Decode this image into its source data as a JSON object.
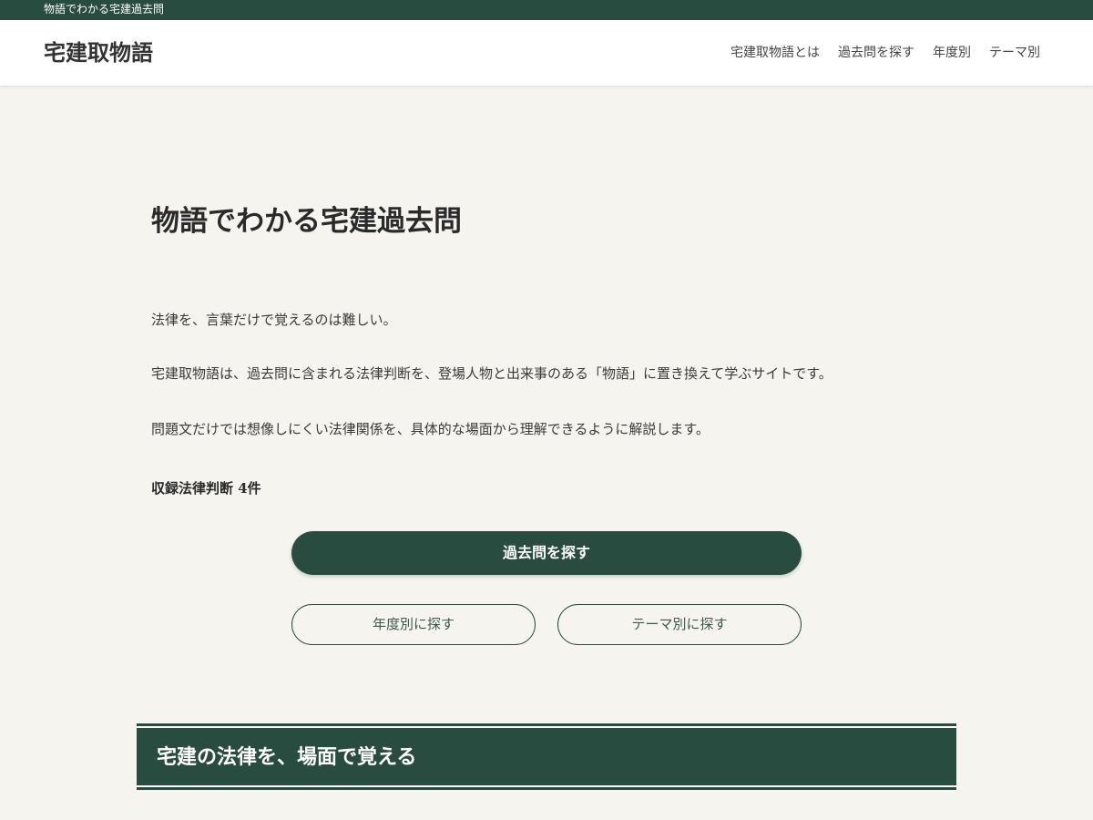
{
  "topbar": {
    "tagline": "物語でわかる宅建過去問"
  },
  "header": {
    "site_title": "宅建取物語",
    "nav": [
      {
        "label": "宅建取物語とは"
      },
      {
        "label": "過去問を探す"
      },
      {
        "label": "年度別"
      },
      {
        "label": "テーマ別"
      }
    ]
  },
  "main": {
    "title": "物語でわかる宅建過去問",
    "paragraphs": [
      "法律を、言葉だけで覚えるのは難しい。",
      "宅建取物語は、過去問に含まれる法律判断を、登場人物と出来事のある「物語」に置き換えて学ぶサイトです。",
      "問題文だけでは想像しにくい法律関係を、具体的な場面から理解できるように解説します。"
    ],
    "count_text": "収録法律判断 4件",
    "primary_button": "過去問を探す",
    "year_button": "年度別に探す",
    "theme_button": "テーマ別に探す"
  },
  "section": {
    "title": "宅建の法律を、場面で覚える"
  },
  "colors": {
    "brand_green": "#284c40",
    "background": "#f5f4ef"
  }
}
